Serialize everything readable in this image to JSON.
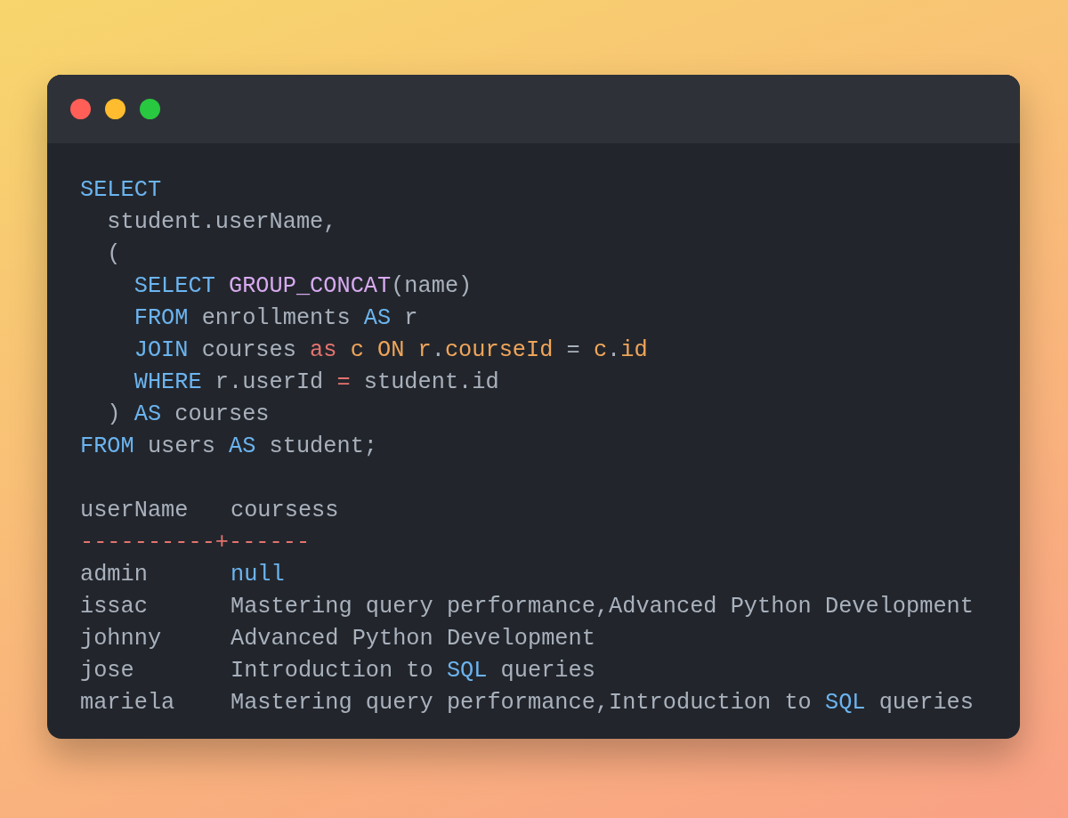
{
  "window": {
    "controls": [
      {
        "color": "#ff5f57"
      },
      {
        "color": "#febc2e"
      },
      {
        "color": "#28c840"
      }
    ]
  },
  "code": [
    [
      {
        "kind": "keyword",
        "text": "SELECT"
      }
    ],
    [
      {
        "kind": "plain",
        "text": "  student.userName,"
      }
    ],
    [
      {
        "kind": "plain",
        "text": "  ("
      }
    ],
    [
      {
        "kind": "keyword",
        "text": "    SELECT "
      },
      {
        "kind": "function",
        "text": "GROUP_CONCAT"
      },
      {
        "kind": "plain",
        "text": "(name)"
      }
    ],
    [
      {
        "kind": "keyword",
        "text": "    FROM"
      },
      {
        "kind": "plain",
        "text": " enrollments "
      },
      {
        "kind": "keyword",
        "text": "AS"
      },
      {
        "kind": "plain",
        "text": " r"
      }
    ],
    [
      {
        "kind": "keyword",
        "text": "    JOIN"
      },
      {
        "kind": "plain",
        "text": " courses "
      },
      {
        "kind": "operator",
        "text": "as"
      },
      {
        "kind": "alias",
        "text": " c ON r"
      },
      {
        "kind": "plain",
        "text": "."
      },
      {
        "kind": "alias",
        "text": "courseId"
      },
      {
        "kind": "plain",
        "text": " = "
      },
      {
        "kind": "alias",
        "text": "c"
      },
      {
        "kind": "plain",
        "text": "."
      },
      {
        "kind": "alias",
        "text": "id"
      }
    ],
    [
      {
        "kind": "keyword",
        "text": "    WHERE"
      },
      {
        "kind": "plain",
        "text": " r.userId "
      },
      {
        "kind": "operator",
        "text": "="
      },
      {
        "kind": "plain",
        "text": " student.id"
      }
    ],
    [
      {
        "kind": "plain",
        "text": "  ) "
      },
      {
        "kind": "keyword",
        "text": "AS"
      },
      {
        "kind": "plain",
        "text": " courses"
      }
    ],
    [
      {
        "kind": "keyword",
        "text": "FROM"
      },
      {
        "kind": "plain",
        "text": " users "
      },
      {
        "kind": "keyword",
        "text": "AS"
      },
      {
        "kind": "plain",
        "text": " student;"
      }
    ]
  ],
  "output": {
    "columns": [
      "userName",
      "coursess"
    ],
    "separator": "----------+------",
    "rows": [
      {
        "user": "admin",
        "courses": [
          {
            "kind": "keyword",
            "text": "null"
          }
        ]
      },
      {
        "user": "issac",
        "courses": [
          {
            "kind": "plain",
            "text": "Mastering query performance,Advanced Python Development"
          }
        ]
      },
      {
        "user": "johnny",
        "courses": [
          {
            "kind": "plain",
            "text": "Advanced Python Development"
          }
        ]
      },
      {
        "user": "jose",
        "courses": [
          {
            "kind": "plain",
            "text": "Introduction to "
          },
          {
            "kind": "keyword",
            "text": "SQL"
          },
          {
            "kind": "plain",
            "text": " queries"
          }
        ]
      },
      {
        "user": "mariela",
        "courses": [
          {
            "kind": "plain",
            "text": "Mastering query performance,Introduction to "
          },
          {
            "kind": "keyword",
            "text": "SQL"
          },
          {
            "kind": "plain",
            "text": " queries"
          }
        ]
      }
    ]
  }
}
